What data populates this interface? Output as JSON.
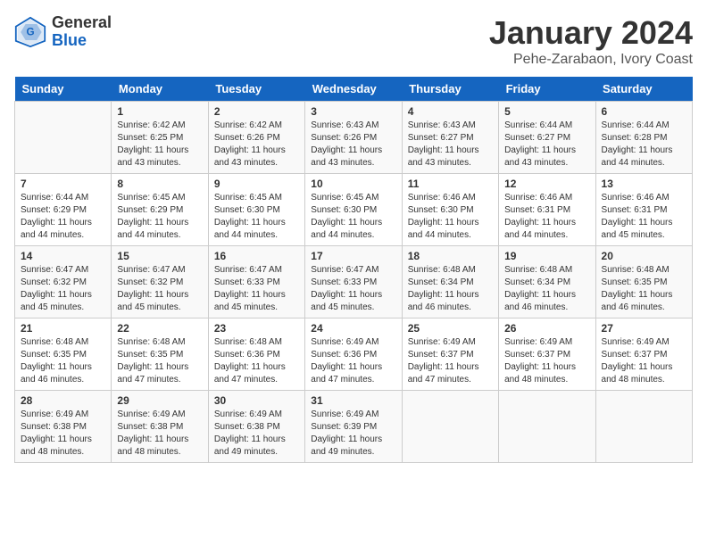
{
  "header": {
    "logo_general": "General",
    "logo_blue": "Blue",
    "month_year": "January 2024",
    "location": "Pehe-Zarabaon, Ivory Coast"
  },
  "weekdays": [
    "Sunday",
    "Monday",
    "Tuesday",
    "Wednesday",
    "Thursday",
    "Friday",
    "Saturday"
  ],
  "weeks": [
    [
      {
        "day": "",
        "sunrise": "",
        "sunset": "",
        "daylight": ""
      },
      {
        "day": "1",
        "sunrise": "Sunrise: 6:42 AM",
        "sunset": "Sunset: 6:25 PM",
        "daylight": "Daylight: 11 hours and 43 minutes."
      },
      {
        "day": "2",
        "sunrise": "Sunrise: 6:42 AM",
        "sunset": "Sunset: 6:26 PM",
        "daylight": "Daylight: 11 hours and 43 minutes."
      },
      {
        "day": "3",
        "sunrise": "Sunrise: 6:43 AM",
        "sunset": "Sunset: 6:26 PM",
        "daylight": "Daylight: 11 hours and 43 minutes."
      },
      {
        "day": "4",
        "sunrise": "Sunrise: 6:43 AM",
        "sunset": "Sunset: 6:27 PM",
        "daylight": "Daylight: 11 hours and 43 minutes."
      },
      {
        "day": "5",
        "sunrise": "Sunrise: 6:44 AM",
        "sunset": "Sunset: 6:27 PM",
        "daylight": "Daylight: 11 hours and 43 minutes."
      },
      {
        "day": "6",
        "sunrise": "Sunrise: 6:44 AM",
        "sunset": "Sunset: 6:28 PM",
        "daylight": "Daylight: 11 hours and 44 minutes."
      }
    ],
    [
      {
        "day": "7",
        "sunrise": "Sunrise: 6:44 AM",
        "sunset": "Sunset: 6:29 PM",
        "daylight": "Daylight: 11 hours and 44 minutes."
      },
      {
        "day": "8",
        "sunrise": "Sunrise: 6:45 AM",
        "sunset": "Sunset: 6:29 PM",
        "daylight": "Daylight: 11 hours and 44 minutes."
      },
      {
        "day": "9",
        "sunrise": "Sunrise: 6:45 AM",
        "sunset": "Sunset: 6:30 PM",
        "daylight": "Daylight: 11 hours and 44 minutes."
      },
      {
        "day": "10",
        "sunrise": "Sunrise: 6:45 AM",
        "sunset": "Sunset: 6:30 PM",
        "daylight": "Daylight: 11 hours and 44 minutes."
      },
      {
        "day": "11",
        "sunrise": "Sunrise: 6:46 AM",
        "sunset": "Sunset: 6:30 PM",
        "daylight": "Daylight: 11 hours and 44 minutes."
      },
      {
        "day": "12",
        "sunrise": "Sunrise: 6:46 AM",
        "sunset": "Sunset: 6:31 PM",
        "daylight": "Daylight: 11 hours and 44 minutes."
      },
      {
        "day": "13",
        "sunrise": "Sunrise: 6:46 AM",
        "sunset": "Sunset: 6:31 PM",
        "daylight": "Daylight: 11 hours and 45 minutes."
      }
    ],
    [
      {
        "day": "14",
        "sunrise": "Sunrise: 6:47 AM",
        "sunset": "Sunset: 6:32 PM",
        "daylight": "Daylight: 11 hours and 45 minutes."
      },
      {
        "day": "15",
        "sunrise": "Sunrise: 6:47 AM",
        "sunset": "Sunset: 6:32 PM",
        "daylight": "Daylight: 11 hours and 45 minutes."
      },
      {
        "day": "16",
        "sunrise": "Sunrise: 6:47 AM",
        "sunset": "Sunset: 6:33 PM",
        "daylight": "Daylight: 11 hours and 45 minutes."
      },
      {
        "day": "17",
        "sunrise": "Sunrise: 6:47 AM",
        "sunset": "Sunset: 6:33 PM",
        "daylight": "Daylight: 11 hours and 45 minutes."
      },
      {
        "day": "18",
        "sunrise": "Sunrise: 6:48 AM",
        "sunset": "Sunset: 6:34 PM",
        "daylight": "Daylight: 11 hours and 46 minutes."
      },
      {
        "day": "19",
        "sunrise": "Sunrise: 6:48 AM",
        "sunset": "Sunset: 6:34 PM",
        "daylight": "Daylight: 11 hours and 46 minutes."
      },
      {
        "day": "20",
        "sunrise": "Sunrise: 6:48 AM",
        "sunset": "Sunset: 6:35 PM",
        "daylight": "Daylight: 11 hours and 46 minutes."
      }
    ],
    [
      {
        "day": "21",
        "sunrise": "Sunrise: 6:48 AM",
        "sunset": "Sunset: 6:35 PM",
        "daylight": "Daylight: 11 hours and 46 minutes."
      },
      {
        "day": "22",
        "sunrise": "Sunrise: 6:48 AM",
        "sunset": "Sunset: 6:35 PM",
        "daylight": "Daylight: 11 hours and 47 minutes."
      },
      {
        "day": "23",
        "sunrise": "Sunrise: 6:48 AM",
        "sunset": "Sunset: 6:36 PM",
        "daylight": "Daylight: 11 hours and 47 minutes."
      },
      {
        "day": "24",
        "sunrise": "Sunrise: 6:49 AM",
        "sunset": "Sunset: 6:36 PM",
        "daylight": "Daylight: 11 hours and 47 minutes."
      },
      {
        "day": "25",
        "sunrise": "Sunrise: 6:49 AM",
        "sunset": "Sunset: 6:37 PM",
        "daylight": "Daylight: 11 hours and 47 minutes."
      },
      {
        "day": "26",
        "sunrise": "Sunrise: 6:49 AM",
        "sunset": "Sunset: 6:37 PM",
        "daylight": "Daylight: 11 hours and 48 minutes."
      },
      {
        "day": "27",
        "sunrise": "Sunrise: 6:49 AM",
        "sunset": "Sunset: 6:37 PM",
        "daylight": "Daylight: 11 hours and 48 minutes."
      }
    ],
    [
      {
        "day": "28",
        "sunrise": "Sunrise: 6:49 AM",
        "sunset": "Sunset: 6:38 PM",
        "daylight": "Daylight: 11 hours and 48 minutes."
      },
      {
        "day": "29",
        "sunrise": "Sunrise: 6:49 AM",
        "sunset": "Sunset: 6:38 PM",
        "daylight": "Daylight: 11 hours and 48 minutes."
      },
      {
        "day": "30",
        "sunrise": "Sunrise: 6:49 AM",
        "sunset": "Sunset: 6:38 PM",
        "daylight": "Daylight: 11 hours and 49 minutes."
      },
      {
        "day": "31",
        "sunrise": "Sunrise: 6:49 AM",
        "sunset": "Sunset: 6:39 PM",
        "daylight": "Daylight: 11 hours and 49 minutes."
      },
      {
        "day": "",
        "sunrise": "",
        "sunset": "",
        "daylight": ""
      },
      {
        "day": "",
        "sunrise": "",
        "sunset": "",
        "daylight": ""
      },
      {
        "day": "",
        "sunrise": "",
        "sunset": "",
        "daylight": ""
      }
    ]
  ]
}
